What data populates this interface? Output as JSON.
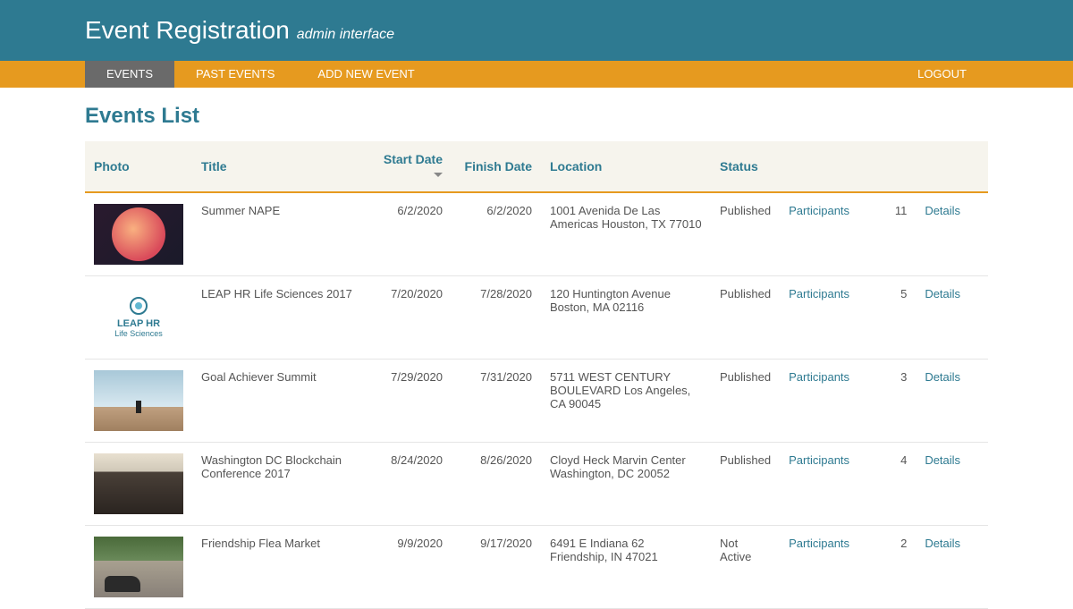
{
  "header": {
    "title": "Event Registration",
    "subtitle": "admin interface"
  },
  "nav": {
    "events": "EVENTS",
    "past": "PAST EVENTS",
    "add": "ADD NEW EVENT",
    "logout": "LOGOUT"
  },
  "page": {
    "title": "Events List"
  },
  "columns": {
    "photo": "Photo",
    "title": "Title",
    "start": "Start Date",
    "finish": "Finish Date",
    "location": "Location",
    "status": "Status"
  },
  "links": {
    "participants": "Participants",
    "details": "Details"
  },
  "events": [
    {
      "photo_class": "nape",
      "title": "Summer NAPE",
      "start": "6/2/2020",
      "finish": "6/2/2020",
      "location": "1001 Avenida De Las Americas Houston, TX 77010",
      "status": "Published",
      "count": "11"
    },
    {
      "photo_class": "leap",
      "title": "LEAP HR Life Sciences 2017",
      "start": "7/20/2020",
      "finish": "7/28/2020",
      "location": "120 Huntington Avenue Boston, MA 02116",
      "status": "Published",
      "count": "5"
    },
    {
      "photo_class": "goal",
      "title": "Goal Achiever Summit",
      "start": "7/29/2020",
      "finish": "7/31/2020",
      "location": "5711 WEST CENTURY BOULEVARD Los Angeles, CA 90045",
      "status": "Published",
      "count": "3"
    },
    {
      "photo_class": "dc",
      "title": "Washington DC Blockchain Conference 2017",
      "start": "8/24/2020",
      "finish": "8/26/2020",
      "location": "Cloyd Heck Marvin Center Washington, DC 20052",
      "status": "Published",
      "count": "4"
    },
    {
      "photo_class": "flea",
      "title": "Friendship Flea Market",
      "start": "9/9/2020",
      "finish": "9/17/2020",
      "location": "6491 E Indiana 62 Friendship, IN 47021",
      "status": "Not Active",
      "count": "2"
    }
  ]
}
